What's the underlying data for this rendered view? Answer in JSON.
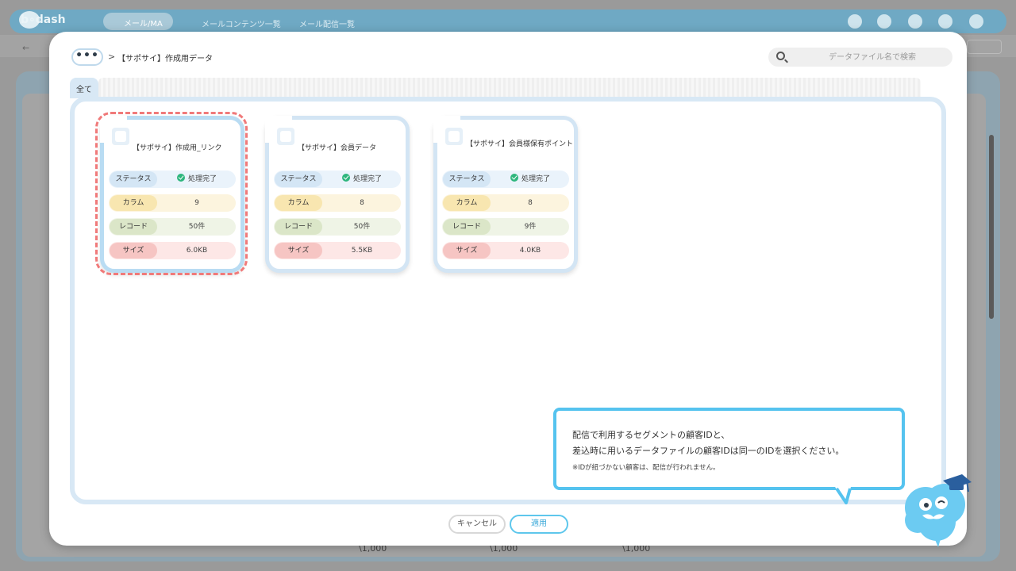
{
  "background_app": {
    "logo": "b∘dash",
    "active_tab": "メール/MA",
    "nav": [
      "メールコンテンツ一覧",
      "メール配信一覧"
    ],
    "prices": [
      "\\1,000",
      "\\1,000",
      "\\1,000"
    ]
  },
  "modal": {
    "more_label": "•••",
    "breadcrumb_sep": ">",
    "breadcrumb": "【サポサイ】作成用データ",
    "search_placeholder": "データファイル名で検索",
    "tab_all": "全て",
    "cards": [
      {
        "title": "【サポサイ】作成用_リンク",
        "selected": true,
        "rows": {
          "status_label": "ステータス",
          "status": "処理完了",
          "column_label": "カラム",
          "columns": "9",
          "record_label": "レコード",
          "records": "50件",
          "size_label": "サイズ",
          "size": "6.0KB"
        }
      },
      {
        "title": "【サポサイ】会員データ",
        "selected": false,
        "rows": {
          "status_label": "ステータス",
          "status": "処理完了",
          "column_label": "カラム",
          "columns": "8",
          "record_label": "レコード",
          "records": "50件",
          "size_label": "サイズ",
          "size": "5.5KB"
        }
      },
      {
        "title": "【サポサイ】会員様保有ポイント",
        "selected": false,
        "rows": {
          "status_label": "ステータス",
          "status": "処理完了",
          "column_label": "カラム",
          "columns": "8",
          "record_label": "レコード",
          "records": "9件",
          "size_label": "サイズ",
          "size": "4.0KB"
        }
      }
    ],
    "cancel_label": "キャンセル",
    "apply_label": "適用",
    "tip": {
      "line1": "配信で利用するセグメントの顧客IDと、",
      "line2": "差込時に用いるデータファイルの顧客IDは同一のIDを選択ください。",
      "note": "※IDが紐づかない顧客は、配信が行われません。"
    }
  },
  "colors": {
    "accent": "#55c3ef",
    "selection": "#f07a7a",
    "status_ok": "#2eb67d"
  }
}
